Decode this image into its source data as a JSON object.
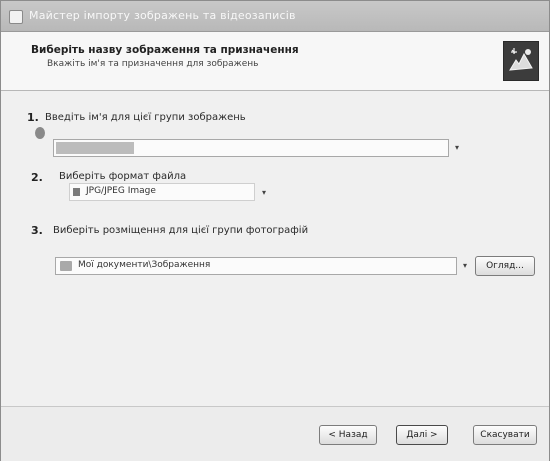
{
  "window": {
    "title": "Майстер імпорту зображень та відеозаписів"
  },
  "header": {
    "title": "Виберіть назву зображення та призначення",
    "subtitle": "Вкажіть ім'я та призначення для зображень"
  },
  "step1": {
    "number": "1.",
    "label": "Введіть ім'я для цієї групи зображень",
    "value": ""
  },
  "step2": {
    "number": "2.",
    "label": "Виберіть формат файла",
    "value": "JPG/JPEG Image"
  },
  "step3": {
    "number": "3.",
    "label": "Виберіть розміщення для цієї групи фотографій",
    "value": "Мої документи\\Зображення",
    "browse_label": "Огляд..."
  },
  "footer": {
    "back_label": "< Назад",
    "next_label": "Далі >",
    "cancel_label": "Скасувати"
  }
}
